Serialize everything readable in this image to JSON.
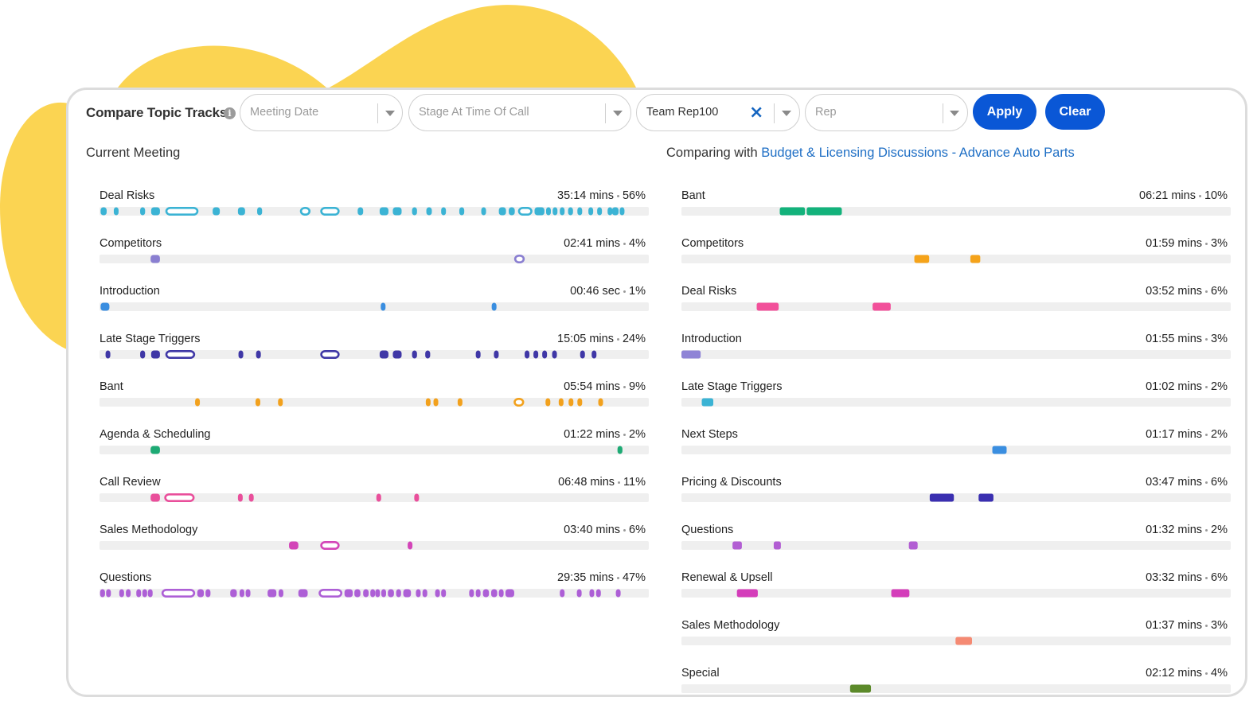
{
  "header": {
    "title": "Compare Topic Tracks",
    "filters": [
      {
        "id": "meeting-date",
        "text": "Meeting Date",
        "filled": false,
        "clearable": false
      },
      {
        "id": "stage",
        "text": "Stage At Time Of Call",
        "filled": false,
        "clearable": false
      },
      {
        "id": "team",
        "text": "Team Rep100",
        "filled": true,
        "clearable": true
      },
      {
        "id": "rep",
        "text": "Rep",
        "filled": false,
        "clearable": false
      }
    ],
    "apply_label": "Apply",
    "clear_label": "Clear"
  },
  "left": {
    "section_label": "Current Meeting",
    "tracks": [
      {
        "name": "Deal Risks",
        "time": "35:14 mins",
        "pct": "56%",
        "color": "#3bb3d4",
        "segments": [
          [
            0.2,
            1.3
          ],
          [
            2.6,
            3.3
          ],
          [
            7.4,
            8.3
          ],
          [
            9.4,
            11
          ],
          [
            12,
            18
          ],
          [
            20.6,
            21.9
          ],
          [
            25.2,
            26.5
          ],
          [
            28.7,
            29.6
          ],
          [
            36.5,
            38.4
          ],
          [
            40.2,
            43.7
          ],
          [
            47,
            48
          ],
          [
            51,
            52.6
          ],
          [
            53.4,
            55
          ],
          [
            56.9,
            57.8
          ],
          [
            59.5,
            60.5
          ],
          [
            62.2,
            63
          ],
          [
            65.5,
            66.4
          ],
          [
            69.5,
            70.3
          ],
          [
            72.7,
            74
          ],
          [
            74.5,
            75.6
          ],
          [
            76.2,
            78.8
          ],
          [
            79.2,
            81
          ],
          [
            81.3,
            82
          ],
          [
            82.5,
            83.3
          ],
          [
            83.8,
            84.4
          ],
          [
            85.3,
            86.2
          ],
          [
            87,
            87.7
          ],
          [
            89,
            89.8
          ],
          [
            90.6,
            91.3
          ],
          [
            92.5,
            93
          ],
          [
            93.3,
            94.5
          ],
          [
            94.7,
            95.4
          ]
        ]
      },
      {
        "name": "Competitors",
        "time": "02:41 mins",
        "pct": "4%",
        "color": "#8a7fd1",
        "segments": [
          [
            9.3,
            11
          ],
          [
            75.5,
            77.4
          ]
        ]
      },
      {
        "name": "Introduction",
        "time": "00:46 sec",
        "pct": "1%",
        "color": "#3a8ee0",
        "segments": [
          [
            0.2,
            1.8
          ],
          [
            51.2,
            52
          ],
          [
            71.4,
            72.2
          ]
        ]
      },
      {
        "name": "Late Stage Triggers",
        "time": "15:05 mins",
        "pct": "24%",
        "color": "#3f37a6",
        "segments": [
          [
            1.1,
            1.8
          ],
          [
            7.4,
            8.3
          ],
          [
            9.4,
            11
          ],
          [
            12,
            17.4
          ],
          [
            25.3,
            26
          ],
          [
            28.5,
            29.2
          ],
          [
            40.2,
            43.7
          ],
          [
            51,
            52.6
          ],
          [
            53.4,
            55
          ],
          [
            56.9,
            57.8
          ],
          [
            59.3,
            60.2
          ],
          [
            68.5,
            69.3
          ],
          [
            71.8,
            72.6
          ],
          [
            77.4,
            78.2
          ],
          [
            79,
            79.8
          ],
          [
            80.6,
            81.4
          ],
          [
            82.4,
            83.2
          ],
          [
            87.5,
            88.3
          ],
          [
            89.6,
            90.4
          ]
        ]
      },
      {
        "name": "Bant",
        "time": "05:54 mins",
        "pct": "9%",
        "color": "#f2a11d",
        "segments": [
          [
            17.4,
            18.2
          ],
          [
            28.4,
            29.2
          ],
          [
            32.5,
            33.3
          ],
          [
            59.4,
            60.2
          ],
          [
            60.8,
            61.6
          ],
          [
            65.2,
            66
          ],
          [
            75.4,
            77.3
          ],
          [
            81.2,
            82
          ],
          [
            83.6,
            84.4
          ],
          [
            85.4,
            86.2
          ],
          [
            87,
            87.7
          ],
          [
            90.8,
            91.6
          ]
        ]
      },
      {
        "name": "Agenda & Scheduling",
        "time": "01:22 mins",
        "pct": "2%",
        "color": "#1daa74",
        "segments": [
          [
            9.3,
            11
          ],
          [
            94.3,
            95.2
          ]
        ]
      },
      {
        "name": "Call Review",
        "time": "06:48 mins",
        "pct": "11%",
        "color": "#e94f9b",
        "segments": [
          [
            9.3,
            11
          ],
          [
            11.8,
            17.3
          ],
          [
            25.2,
            26
          ],
          [
            27.2,
            28
          ],
          [
            50.4,
            51.2
          ],
          [
            57.3,
            58.1
          ]
        ]
      },
      {
        "name": "Sales Methodology",
        "time": "03:40 mins",
        "pct": "6%",
        "color": "#d345b8",
        "segments": [
          [
            34.5,
            36.2
          ],
          [
            40.2,
            43.7
          ],
          [
            56.1,
            56.9
          ]
        ]
      },
      {
        "name": "Questions",
        "time": "29:35 mins",
        "pct": "47%",
        "color": "#ad5fd6",
        "segments": [
          [
            0.1,
            1
          ],
          [
            1.2,
            1.9
          ],
          [
            3.6,
            4.3
          ],
          [
            4.8,
            5.6
          ],
          [
            6.7,
            7.4
          ],
          [
            7.8,
            8.5
          ],
          [
            8.8,
            9.6
          ],
          [
            11.3,
            17.4
          ],
          [
            17.8,
            19
          ],
          [
            19.3,
            20.2
          ],
          [
            23.8,
            25
          ],
          [
            25.5,
            26.3
          ],
          [
            26.6,
            27.4
          ],
          [
            30.6,
            32.2
          ],
          [
            32.6,
            33.4
          ],
          [
            36.2,
            37.9
          ],
          [
            39.9,
            44.2
          ],
          [
            44.6,
            46.1
          ],
          [
            46.4,
            47.5
          ],
          [
            48,
            49
          ],
          [
            49.3,
            50
          ],
          [
            50.2,
            51
          ],
          [
            51.3,
            52.1
          ],
          [
            52.5,
            53.6
          ],
          [
            54,
            54.9
          ],
          [
            55.3,
            56.7
          ],
          [
            57.6,
            58.3
          ],
          [
            58.8,
            59.6
          ],
          [
            61.1,
            61.8
          ],
          [
            62.2,
            63
          ],
          [
            67.3,
            68
          ],
          [
            68.5,
            69.3
          ],
          [
            69.8,
            70.9
          ],
          [
            71.3,
            72.4
          ],
          [
            72.7,
            73.5
          ],
          [
            73.9,
            75.5
          ],
          [
            83.8,
            84.6
          ],
          [
            86.9,
            87.6
          ],
          [
            89.2,
            90
          ],
          [
            90.4,
            91.2
          ],
          [
            94,
            94.8
          ]
        ]
      }
    ]
  },
  "right": {
    "section_prefix": "Comparing with ",
    "section_link": "Budget & Licensing Discussions - Advance Auto Parts",
    "tracks": [
      {
        "name": "Bant",
        "time": "06:21 mins",
        "pct": "10%",
        "color": "#13b27b",
        "segments": [
          [
            17.9,
            22.5
          ],
          [
            22.8,
            29.2
          ]
        ]
      },
      {
        "name": "Competitors",
        "time": "01:59 mins",
        "pct": "3%",
        "color": "#f5a31a",
        "segments": [
          [
            42.4,
            45.1
          ],
          [
            52.6,
            54.4
          ]
        ]
      },
      {
        "name": "Deal Risks",
        "time": "03:52 mins",
        "pct": "6%",
        "color": "#f2509a",
        "segments": [
          [
            13.7,
            17.7
          ],
          [
            34.8,
            38.1
          ]
        ]
      },
      {
        "name": "Introduction",
        "time": "01:55 mins",
        "pct": "3%",
        "color": "#8f84d6",
        "segments": [
          [
            0,
            3.5
          ]
        ]
      },
      {
        "name": "Late Stage Triggers",
        "time": "01:02 mins",
        "pct": "2%",
        "color": "#3bb3d4",
        "segments": [
          [
            3.7,
            5.8
          ]
        ]
      },
      {
        "name": "Next Steps",
        "time": "01:17 mins",
        "pct": "2%",
        "color": "#3a8ee0",
        "segments": [
          [
            56.6,
            59.2
          ]
        ]
      },
      {
        "name": "Pricing & Discounts",
        "time": "03:47 mins",
        "pct": "6%",
        "color": "#3a2fb0",
        "segments": [
          [
            45.2,
            49.6
          ],
          [
            54.1,
            56.8
          ]
        ]
      },
      {
        "name": "Questions",
        "time": "01:32 mins",
        "pct": "2%",
        "color": "#b25ed3",
        "segments": [
          [
            9.3,
            11
          ],
          [
            16.8,
            18.1
          ],
          [
            41.4,
            43
          ]
        ]
      },
      {
        "name": "Renewal & Upsell",
        "time": "03:32 mins",
        "pct": "6%",
        "color": "#d43dba",
        "segments": [
          [
            10.1,
            13.9
          ],
          [
            38.2,
            41.5
          ]
        ]
      },
      {
        "name": "Sales Methodology",
        "time": "01:37 mins",
        "pct": "3%",
        "color": "#f58a73",
        "segments": [
          [
            49.9,
            52.9
          ]
        ]
      },
      {
        "name": "Special",
        "time": "02:12 mins",
        "pct": "4%",
        "color": "#5c8a2a",
        "segments": [
          [
            30.7,
            34.5
          ]
        ]
      }
    ]
  }
}
